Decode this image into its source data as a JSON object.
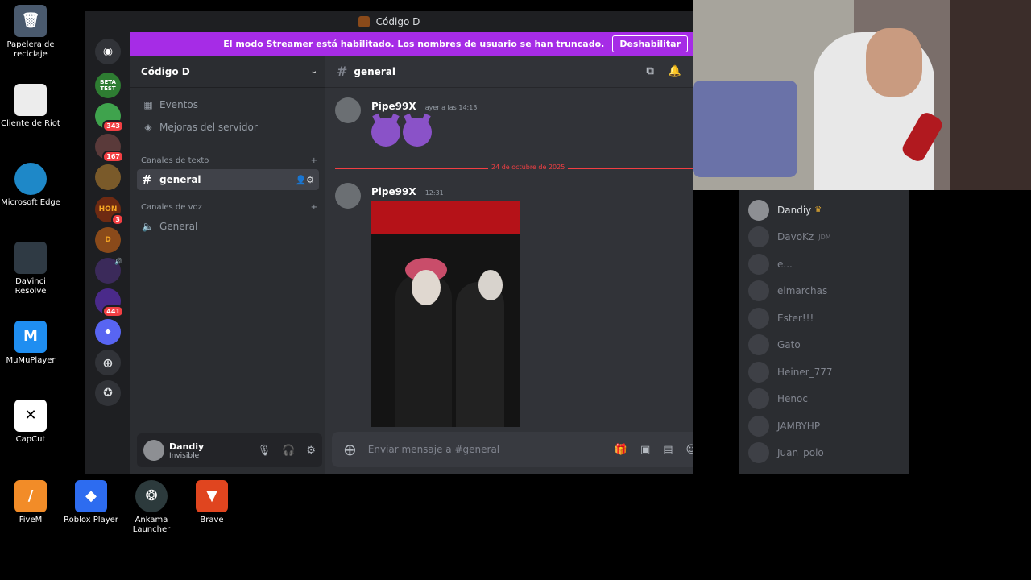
{
  "desktop_icons": [
    {
      "label": "Papelera de reciclaje",
      "color": "#4a5a6e"
    },
    {
      "label": "Cliente de Riot",
      "color": "#ececec"
    },
    {
      "label": "Microsoft Edge",
      "color": "#1e88c8"
    },
    {
      "label": "DaVinci Resolve",
      "color": "#2f3a44"
    },
    {
      "label": "MuMuPlayer",
      "color": "#1f8ef1"
    },
    {
      "label": "CapCut",
      "color": "#ffffff"
    },
    {
      "label": "FiveM",
      "color": "#f28c28"
    },
    {
      "label": "Roblox Player",
      "color": "#2d6cf0"
    },
    {
      "label": "Ankama Launcher",
      "color": "#2c3a3c"
    },
    {
      "label": "Brave",
      "color": "#e0451f"
    }
  ],
  "window": {
    "title": "Código D",
    "banner_text": "El modo Streamer está habilitado. Los nombres de usuario se han truncado.",
    "banner_button": "Deshabilitar"
  },
  "servers": [
    {
      "label": "BETA TEST",
      "badge": ""
    },
    {
      "label": "",
      "badge": "343"
    },
    {
      "label": "",
      "badge": "167"
    },
    {
      "label": "",
      "badge": ""
    },
    {
      "label": "HON",
      "badge": "3"
    },
    {
      "label": "D",
      "badge": ""
    },
    {
      "label": "",
      "badge": ""
    },
    {
      "label": "",
      "badge": "441"
    }
  ],
  "sidebar": {
    "guild_name": "Código D",
    "items": [
      "Eventos",
      "Mejoras del servidor"
    ],
    "text_category": "Canales de texto",
    "text_channels": [
      "general"
    ],
    "voice_category": "Canales de voz",
    "voice_channels": [
      "General"
    ]
  },
  "user_panel": {
    "name": "Dandiy",
    "status": "Invisible"
  },
  "channel": {
    "name": "general"
  },
  "messages": [
    {
      "author": "Pipe99X",
      "time": "ayer a las 14:13"
    },
    {
      "author": "Pipe99X",
      "time": "12:31"
    }
  ],
  "date_divider": "24 de octubre de 2025",
  "composer": {
    "placeholder": "Enviar mensaje a #general"
  },
  "members": [
    {
      "name": "Dandiy",
      "tag": "",
      "online": true
    },
    {
      "name": "DavoKz",
      "tag": "JDM",
      "online": false
    },
    {
      "name": "e...",
      "tag": "",
      "online": false
    },
    {
      "name": "elmarchas",
      "tag": "",
      "online": false
    },
    {
      "name": "Ester!!!",
      "tag": "",
      "online": false
    },
    {
      "name": "Gato",
      "tag": "",
      "online": false
    },
    {
      "name": "Heiner_777",
      "tag": "",
      "online": false
    },
    {
      "name": "Henoc",
      "tag": "",
      "online": false
    },
    {
      "name": "JAMBYHP",
      "tag": "",
      "online": false
    },
    {
      "name": "Juan_polo",
      "tag": "",
      "online": false
    }
  ]
}
